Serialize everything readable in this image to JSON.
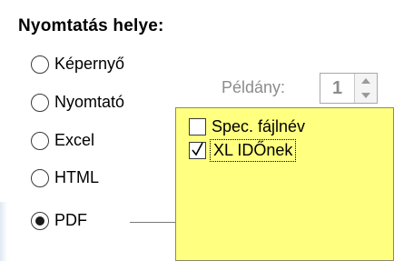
{
  "group": {
    "title": "Nyomtatás helye:"
  },
  "destinations": [
    {
      "label": "Képernyő",
      "selected": false
    },
    {
      "label": "Nyomtató",
      "selected": false
    },
    {
      "label": "Excel",
      "selected": false
    },
    {
      "label": "HTML",
      "selected": false
    },
    {
      "label": "PDF",
      "selected": true
    }
  ],
  "copies": {
    "label": "Példány:",
    "value": "1"
  },
  "options_panel": {
    "color": "#ffff80",
    "items": [
      {
        "label": "Spec. fájlnév",
        "checked": false
      },
      {
        "label": "XL IDŐnek",
        "checked": true,
        "focused": true
      }
    ]
  }
}
